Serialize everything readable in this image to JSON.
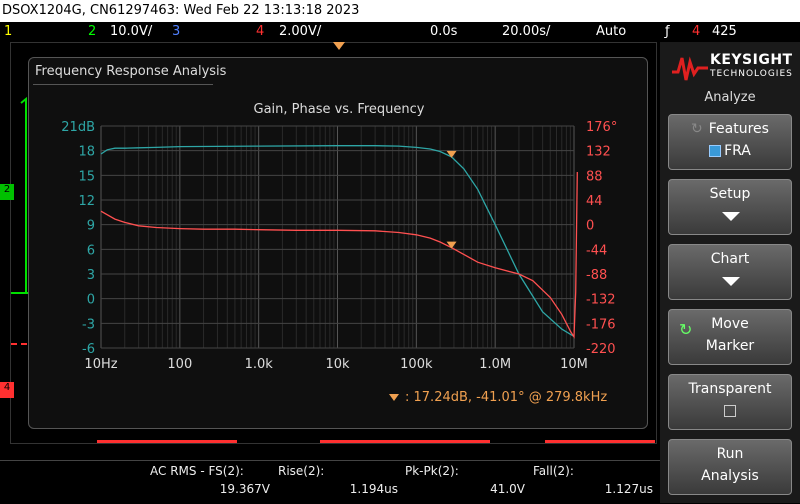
{
  "title_bar": "DSOX1204G, CN61297463: Wed Feb 22 13:13:18 2023",
  "channels": {
    "ch1_num": "1",
    "ch2_num": "2",
    "ch2_scale": "10.0V/",
    "ch3_num": "3",
    "ch4_num": "4",
    "ch4_scale": "2.00V/",
    "time_pos": "0.0s",
    "time_scale": "20.00s/",
    "trigger_mode": "Auto",
    "trig_ch": "4",
    "trig_level": "425"
  },
  "dialog": {
    "title": "Frequency Response Analysis",
    "chart_title": "Gain, Phase vs. Frequency",
    "marker_readout": "17.24dB, -41.01° @ 279.8kHz"
  },
  "chart_data": {
    "type": "line",
    "title": "Gain, Phase vs. Frequency",
    "x_scale": "log",
    "x_range": [
      10,
      10000000
    ],
    "x_ticks": [
      "10Hz",
      "100",
      "1.0k",
      "10k",
      "100k",
      "1.0M",
      "10M"
    ],
    "y_left_range": [
      -6,
      21
    ],
    "y_left_ticks": [
      "21dB",
      "18",
      "15",
      "12",
      "9",
      "6",
      "3",
      "0",
      "-3",
      "-6"
    ],
    "y_right_range": [
      -220,
      176
    ],
    "y_right_ticks": [
      "176°",
      "132",
      "88",
      "44",
      "0",
      "-44",
      "-88",
      "-132",
      "-176",
      "-220"
    ],
    "grid": true,
    "series": [
      {
        "color": "#2ea6a6",
        "axis": "left",
        "x": [
          10,
          12,
          15,
          20,
          30,
          50,
          100,
          1000,
          10000,
          30000,
          60000,
          100000,
          150000,
          200000,
          279800,
          400000,
          600000,
          1000000,
          2000000,
          4000000,
          7000000,
          10000000
        ],
        "y": [
          17.6,
          18.1,
          18.3,
          18.3,
          18.35,
          18.4,
          18.5,
          18.55,
          18.6,
          18.6,
          18.55,
          18.4,
          18.2,
          17.9,
          17.24,
          15.8,
          13.3,
          9.0,
          3.0,
          -1.6,
          -3.7,
          -4.6
        ]
      },
      {
        "color": "#ff5050",
        "axis": "right",
        "x": [
          10,
          15,
          20,
          30,
          50,
          100,
          200,
          500,
          1000,
          3000,
          10000,
          30000,
          60000,
          100000,
          150000,
          200000,
          279800,
          400000,
          600000,
          1000000,
          2000000,
          3000000,
          5000000,
          7000000,
          9000000,
          10000000,
          10500000,
          11000000
        ],
        "y": [
          24,
          10,
          4,
          -2,
          -5,
          -7,
          -8,
          -8,
          -9,
          -10,
          -10,
          -11,
          -14,
          -18,
          -24,
          -31,
          -41,
          -53,
          -67,
          -77,
          -88,
          -100,
          -130,
          -160,
          -190,
          -200,
          -120,
          94
        ]
      }
    ],
    "marker": {
      "x": 279800,
      "gain_db": 17.24,
      "phase_deg": -41.01
    }
  },
  "side_panel": {
    "brand": "KEYSIGHT",
    "brand_sub": "TECHNOLOGIES",
    "section": "Analyze",
    "buttons": [
      {
        "line1": "Features",
        "line2": "FRA"
      },
      {
        "line1": "Setup"
      },
      {
        "line1": "Chart"
      },
      {
        "line1": "Move",
        "line2": "Marker"
      },
      {
        "line1": "Transparent"
      },
      {
        "line1": "Run",
        "line2": "Analysis"
      }
    ]
  },
  "measurements": [
    {
      "label": "AC RMS - FS(2):",
      "value": "19.367V"
    },
    {
      "label": "Rise(2):",
      "value": "1.194us"
    },
    {
      "label": "Pk-Pk(2):",
      "value": "41.0V"
    },
    {
      "label": "Fall(2):",
      "value": "1.127us"
    }
  ],
  "colors": {
    "gain": "#2ea6a6",
    "phase": "#ff5050",
    "marker": "#f0a050",
    "ch1": "#ffff00",
    "ch2": "#00ff00",
    "ch3": "#5080ff",
    "ch4": "#ff3030"
  }
}
